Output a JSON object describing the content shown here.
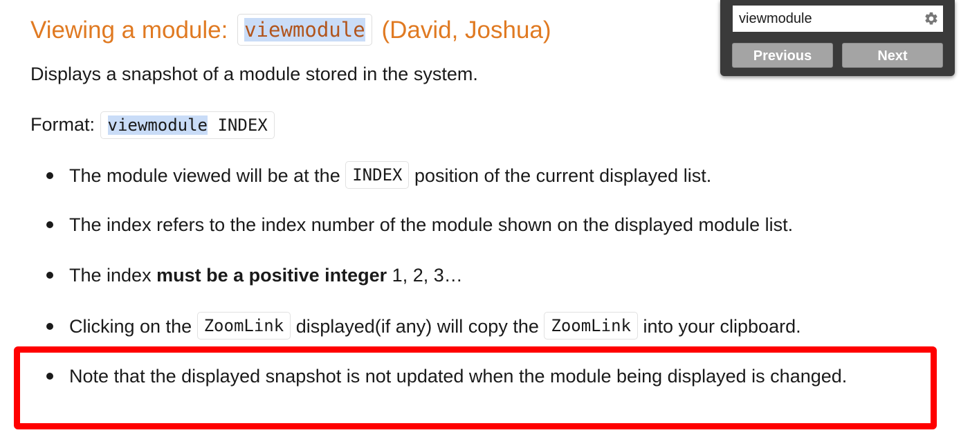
{
  "heading": {
    "prefix": "Viewing a module: ",
    "command": "viewmodule",
    "authors": "(David, Joshua)"
  },
  "description": "Displays a snapshot of a module stored in the system.",
  "format": {
    "label": "Format: ",
    "command": "viewmodule",
    "argument": " INDEX"
  },
  "bullets": [
    {
      "before": "The module viewed will be at the ",
      "code": "INDEX",
      "after": " position of the current displayed list."
    },
    {
      "text": "The index refers to the index number of the module shown on the displayed module list."
    },
    {
      "before": "The index ",
      "bold": "must be a positive integer",
      "after": " 1, 2, 3…"
    },
    {
      "before": "Clicking on the ",
      "code1": "ZoomLink",
      "middle": " displayed(if any) will copy the ",
      "code2": "ZoomLink",
      "after": " into your clipboard."
    },
    {
      "text": "Note that the displayed snapshot is not updated when the module being displayed is changed."
    }
  ],
  "find_bar": {
    "query": "viewmodule",
    "settings_icon": "gear-icon",
    "previous_label": "Previous",
    "next_label": "Next"
  },
  "colors": {
    "heading": "#e07a22",
    "match_highlight": "#c9dcf7",
    "annotation_box": "#ff0000",
    "find_bar_bg": "#3a3a3a",
    "find_button_bg": "#a4a4a4"
  }
}
